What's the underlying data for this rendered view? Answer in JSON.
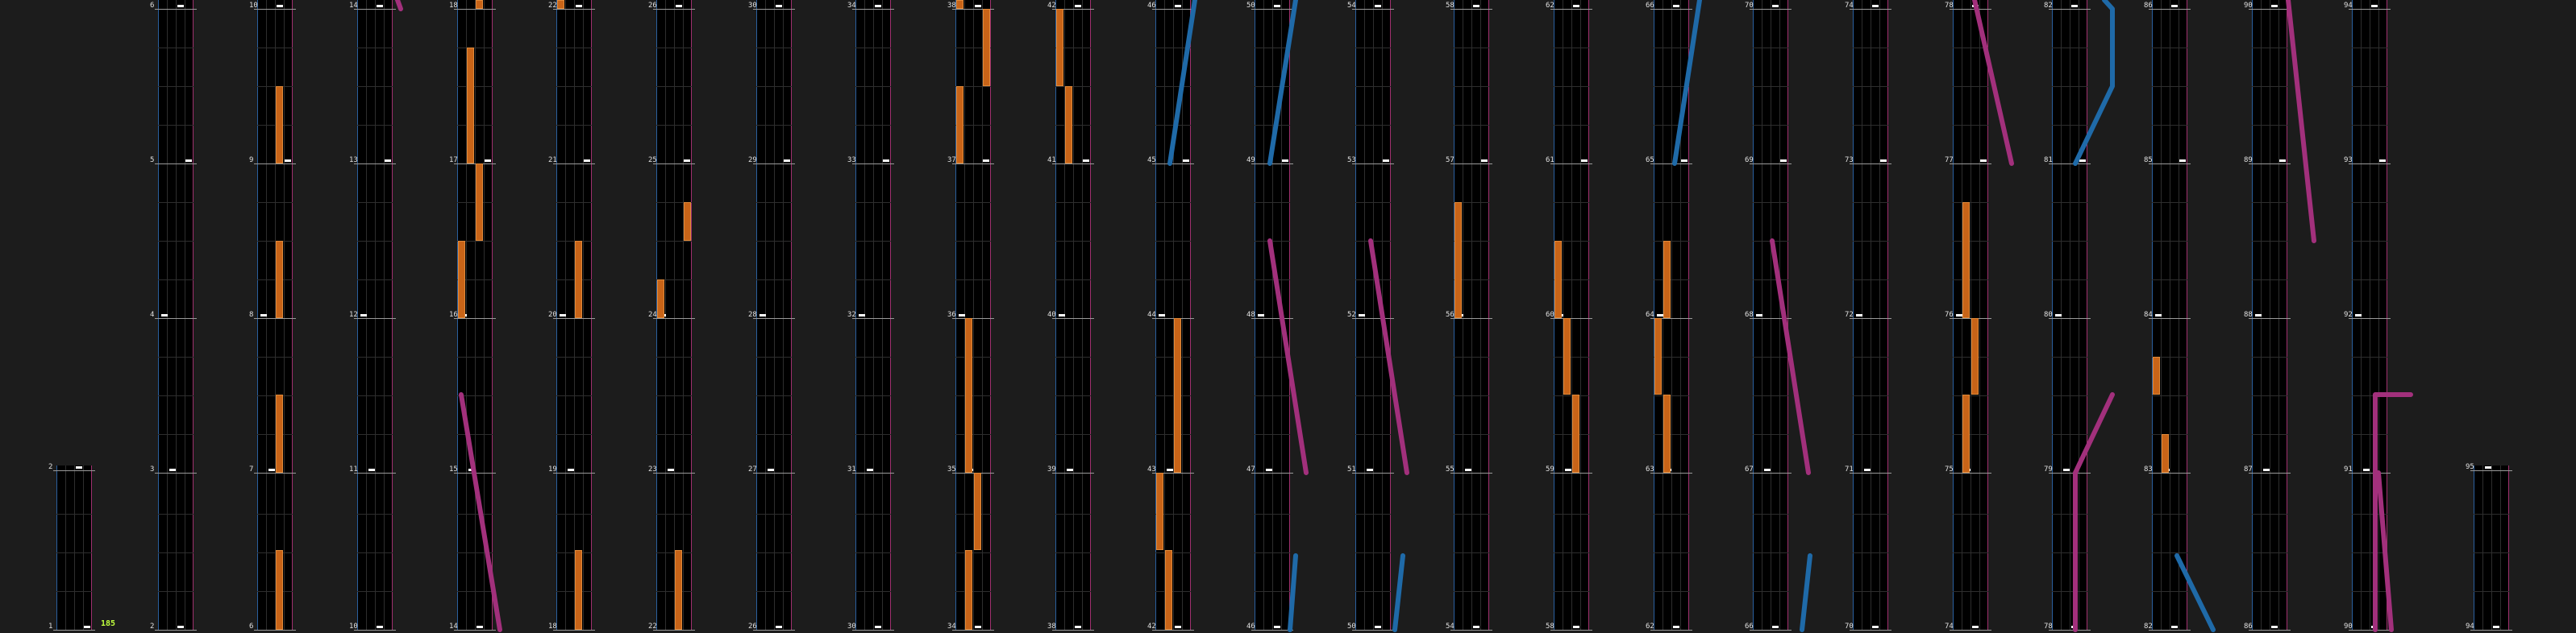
{
  "colors": {
    "background": "#1c1c1c",
    "column_bg": "#000000",
    "grid": "#2e2e2e",
    "left_border": "#2a5f9e",
    "right_border": "#a0306e",
    "measure_line": "#9a9a9a",
    "note_tap": "#ffffff",
    "note_hold": "#c86418",
    "slide_blue": "#1f6aa8",
    "slide_pink": "#a2307c",
    "bpm": "#c0ff3e"
  },
  "bpm": "185",
  "columns": [
    {
      "measures": [
        1,
        2
      ]
    },
    {
      "measures": [
        2,
        3,
        4,
        5,
        6
      ]
    },
    {
      "measures": [
        6,
        7,
        8,
        9,
        10
      ]
    },
    {
      "measures": [
        10,
        11,
        12,
        13,
        14
      ]
    },
    {
      "measures": [
        14,
        15,
        16,
        17,
        18
      ]
    },
    {
      "measures": [
        18,
        19,
        20,
        21,
        22
      ]
    },
    {
      "measures": [
        22,
        23,
        24,
        25,
        26
      ]
    },
    {
      "measures": [
        26,
        27,
        28,
        29,
        30
      ]
    },
    {
      "measures": [
        30,
        31,
        32,
        33,
        34
      ]
    },
    {
      "measures": [
        34,
        35,
        36,
        37,
        38
      ]
    },
    {
      "measures": [
        38,
        39,
        40,
        41,
        42
      ]
    },
    {
      "measures": [
        42,
        43,
        44,
        45,
        46
      ]
    },
    {
      "measures": [
        46,
        47,
        48,
        49,
        50
      ]
    },
    {
      "measures": [
        50,
        51,
        52,
        53,
        54
      ]
    },
    {
      "measures": [
        54,
        55,
        56,
        57,
        58
      ]
    },
    {
      "measures": [
        58,
        59,
        60,
        61,
        62
      ]
    },
    {
      "measures": [
        62,
        63,
        64,
        65,
        66
      ]
    },
    {
      "measures": [
        66,
        67,
        68,
        69,
        70
      ]
    },
    {
      "measures": [
        70,
        71,
        72,
        73,
        74
      ]
    },
    {
      "measures": [
        74,
        75,
        76,
        77,
        78
      ]
    },
    {
      "measures": [
        78,
        79,
        80,
        81,
        82
      ]
    },
    {
      "measures": [
        82,
        83,
        84,
        85,
        86
      ]
    },
    {
      "measures": [
        86,
        87,
        88,
        89,
        90
      ]
    },
    {
      "measures": [
        90,
        91,
        92,
        93,
        94
      ]
    },
    {
      "measures": [
        94,
        95
      ]
    }
  ]
}
